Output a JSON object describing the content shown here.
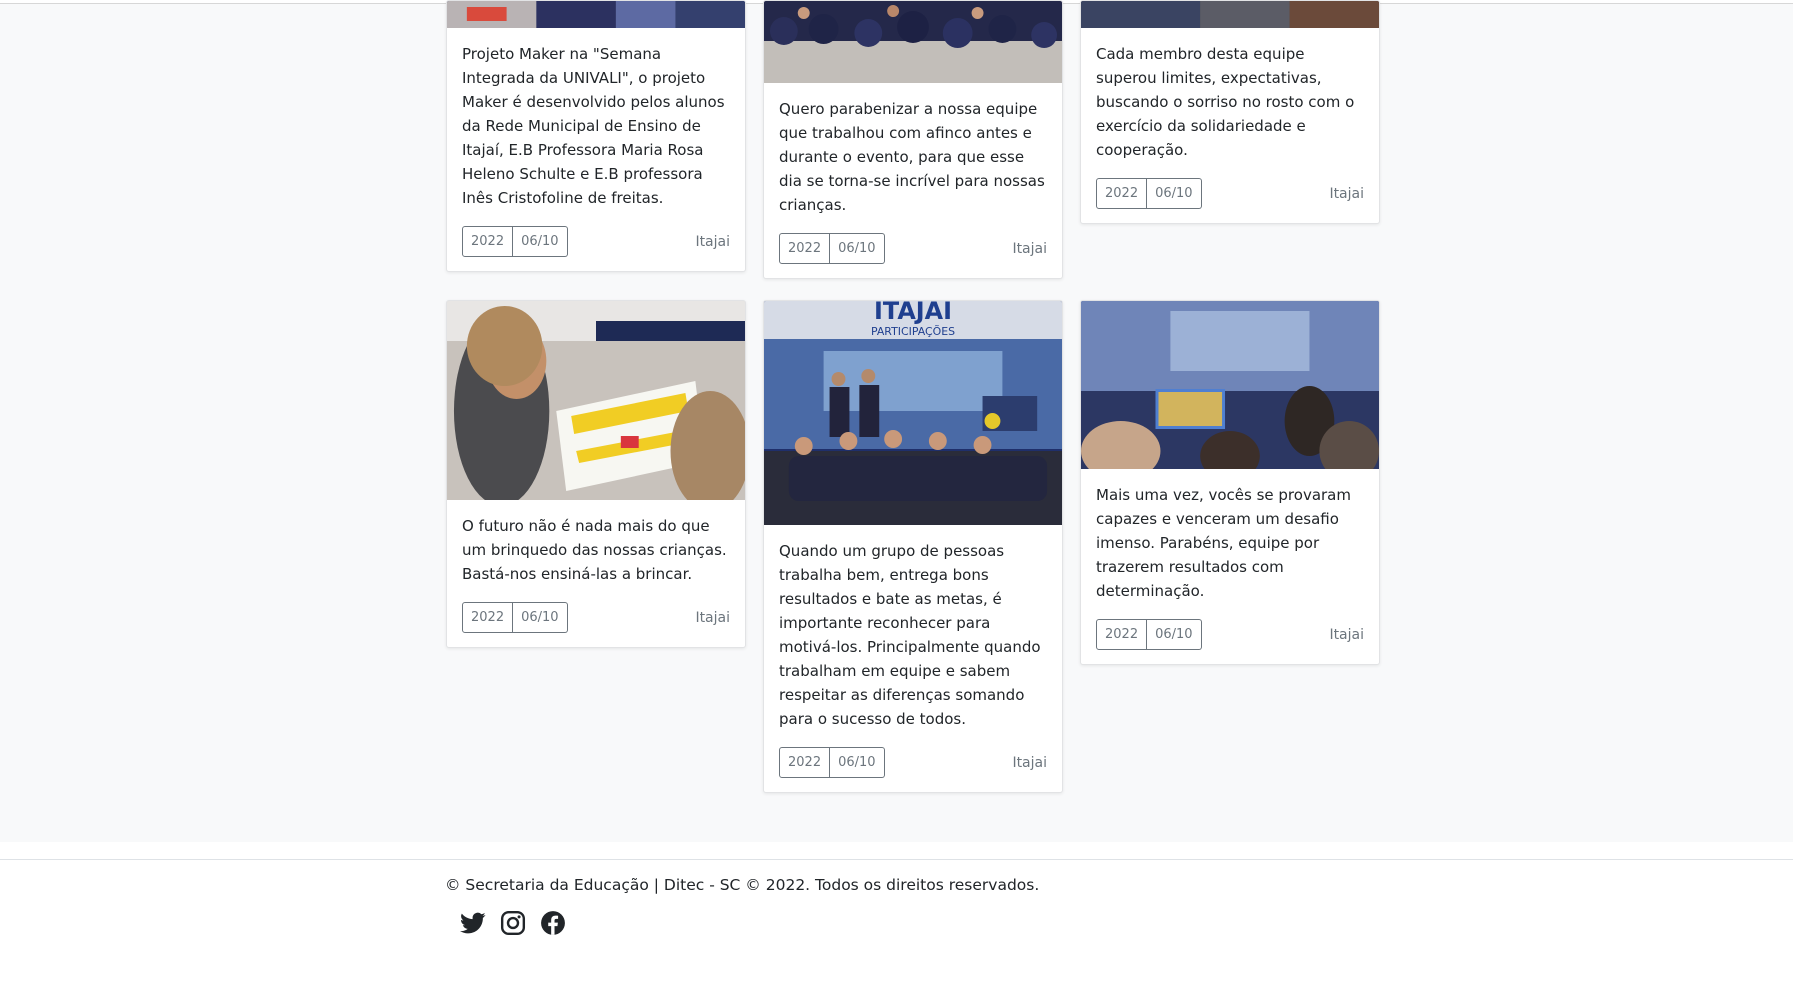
{
  "cards": [
    {
      "text": "Projeto Maker na \"Semana Integrada da UNIVALI\", o projeto Maker é desenvolvido pelos alunos da Rede Municipal de Ensino de Itajaí, E.B Professora Maria Rosa Heleno Schulte e E.B professora Inês Cristofoline de freitas.",
      "year": "2022",
      "date": "06/10",
      "city": "Itajai"
    },
    {
      "text": "Quero parabenizar a nossa equipe que trabalhou com afinco antes e durante o evento, para que esse dia se torna-se incrível para nossas crianças.",
      "year": "2022",
      "date": "06/10",
      "city": "Itajai"
    },
    {
      "text": "Cada membro desta equipe superou limites, expectativas, buscando o sorriso no rosto com o exercício da solidariedade e cooperação.",
      "year": "2022",
      "date": "06/10",
      "city": "Itajai"
    },
    {
      "text": "O futuro não é nada mais do que um brinquedo das nossas crianças. Bastá-nos ensiná-las a brincar.",
      "year": "2022",
      "date": "06/10",
      "city": "Itajai"
    },
    {
      "text": "Quando um grupo de pessoas trabalha bem, entrega bons resultados e bate as metas, é importante reconhecer para motivá-los. Principalmente quando trabalham em equipe e sabem respeitar as diferenças somando para o sucesso de todos.",
      "year": "2022",
      "date": "06/10",
      "city": "Itajai"
    },
    {
      "text": "Mais uma vez, vocês se provaram capazes e venceram um desafio imenso. Parabéns, equipe por trazerem resultados com determinação.",
      "year": "2022",
      "date": "06/10",
      "city": "Itajai"
    }
  ],
  "photo_signage": {
    "brand": "ITAJAI",
    "sub": "PARTICIPAÇÕES"
  },
  "footer": {
    "copyright": "© Secretaria da Educação | Ditec - SC © 2022. Todos os direitos reservados.",
    "social": [
      "twitter-icon",
      "instagram-icon",
      "facebook-icon"
    ]
  }
}
